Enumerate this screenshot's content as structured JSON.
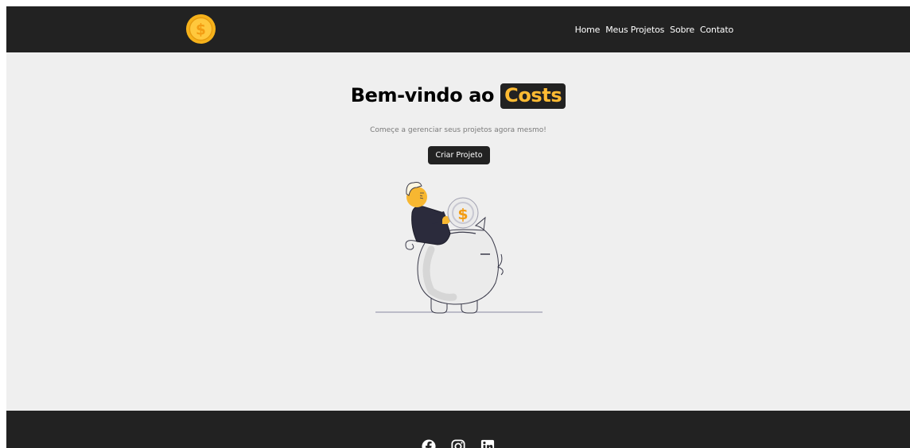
{
  "navbar": {
    "logo_icon": "dollar-coin-icon",
    "links": [
      {
        "label": "Home"
      },
      {
        "label": "Meus Projetos"
      },
      {
        "label": "Sobre"
      },
      {
        "label": "Contato"
      }
    ]
  },
  "hero": {
    "title_prefix": "Bem-vindo ao",
    "title_brand": "Costs",
    "subtitle": "Começe a gerenciar seus projetos agora mesmo!",
    "cta_label": "Criar Projeto",
    "illustration": "savings-piggy-bank-illustration"
  },
  "footer": {
    "social": [
      "facebook-icon",
      "instagram-icon",
      "linkedin-icon"
    ]
  },
  "colors": {
    "dark": "#222222",
    "accent": "#ffbb33",
    "background": "#efefef"
  }
}
